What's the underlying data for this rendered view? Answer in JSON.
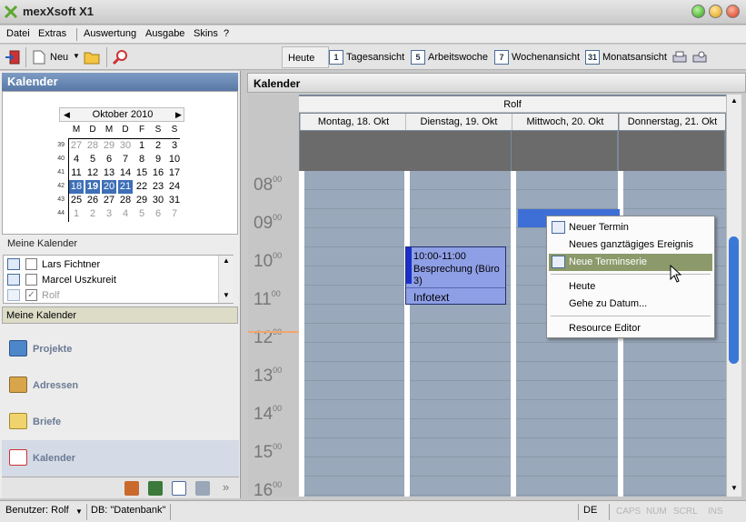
{
  "window": {
    "title": "mexXsoft X1"
  },
  "menu": [
    "Datei",
    "Extras",
    "Auswertung",
    "Ausgabe",
    "Skins",
    "?"
  ],
  "toolbar": {
    "new_label": "Neu",
    "today_label": "Heute",
    "views": [
      {
        "icon": "1",
        "label": "Tagesansicht"
      },
      {
        "icon": "5",
        "label": "Arbeitswoche"
      },
      {
        "icon": "7",
        "label": "Wochenansicht"
      },
      {
        "icon": "31",
        "label": "Monatsansicht"
      }
    ]
  },
  "sidebar": {
    "title": "Kalender",
    "mini_calendar": {
      "month": "Oktober 2010",
      "weekdays": [
        "M",
        "D",
        "M",
        "D",
        "F",
        "S",
        "S"
      ],
      "weeks": [
        {
          "no": "39",
          "days": [
            "27",
            "28",
            "29",
            "30",
            "1",
            "2",
            "3"
          ]
        },
        {
          "no": "40",
          "days": [
            "4",
            "5",
            "6",
            "7",
            "8",
            "9",
            "10"
          ]
        },
        {
          "no": "41",
          "days": [
            "11",
            "12",
            "13",
            "14",
            "15",
            "16",
            "17"
          ]
        },
        {
          "no": "42",
          "days": [
            "18",
            "19",
            "20",
            "21",
            "22",
            "23",
            "24"
          ]
        },
        {
          "no": "43",
          "days": [
            "25",
            "26",
            "27",
            "28",
            "29",
            "30",
            "31"
          ]
        },
        {
          "no": "44",
          "days": [
            "1",
            "2",
            "3",
            "4",
            "5",
            "6",
            "7"
          ]
        }
      ]
    },
    "my_calendars_label": "Meine Kalender",
    "calendars": [
      {
        "name": "Lars Fichtner",
        "checked": false
      },
      {
        "name": "Marcel Uszkureit",
        "checked": false
      },
      {
        "name": "Rolf",
        "checked": true
      }
    ],
    "my_calendars_bar": "Meine Kalender",
    "nav": [
      "Projekte",
      "Adressen",
      "Briefe",
      "Kalender"
    ]
  },
  "main": {
    "header": "Kalender",
    "resource": "Rolf",
    "days": [
      "Montag, 18. Okt",
      "Dienstag, 19. Okt",
      "Mittwoch, 20. Okt",
      "Donnerstag, 21. Okt"
    ],
    "hours": [
      "08",
      "09",
      "10",
      "11",
      "12",
      "13",
      "14",
      "15",
      "16"
    ],
    "minutes": "00",
    "event": {
      "time": "10:00-11:00",
      "title": "Besprechung (Büro 3)",
      "info": "Infotext"
    }
  },
  "context_menu": {
    "items": [
      "Neuer Termin",
      "Neues ganztägiges Ereignis",
      "Neue Terminserie",
      "Heute",
      "Gehe zu Datum...",
      "Resource Editor"
    ]
  },
  "status": {
    "user": "Benutzer: Rolf",
    "db": "DB: \"Datenbank\"",
    "lang": "DE",
    "caps": "CAPS",
    "num": "NUM",
    "scrl": "SCRL",
    "ins": "INS"
  },
  "colors": {
    "accent": "#3e6fb7",
    "event": "#8f9fe6",
    "menu_highlight": "#8c9a6b"
  }
}
